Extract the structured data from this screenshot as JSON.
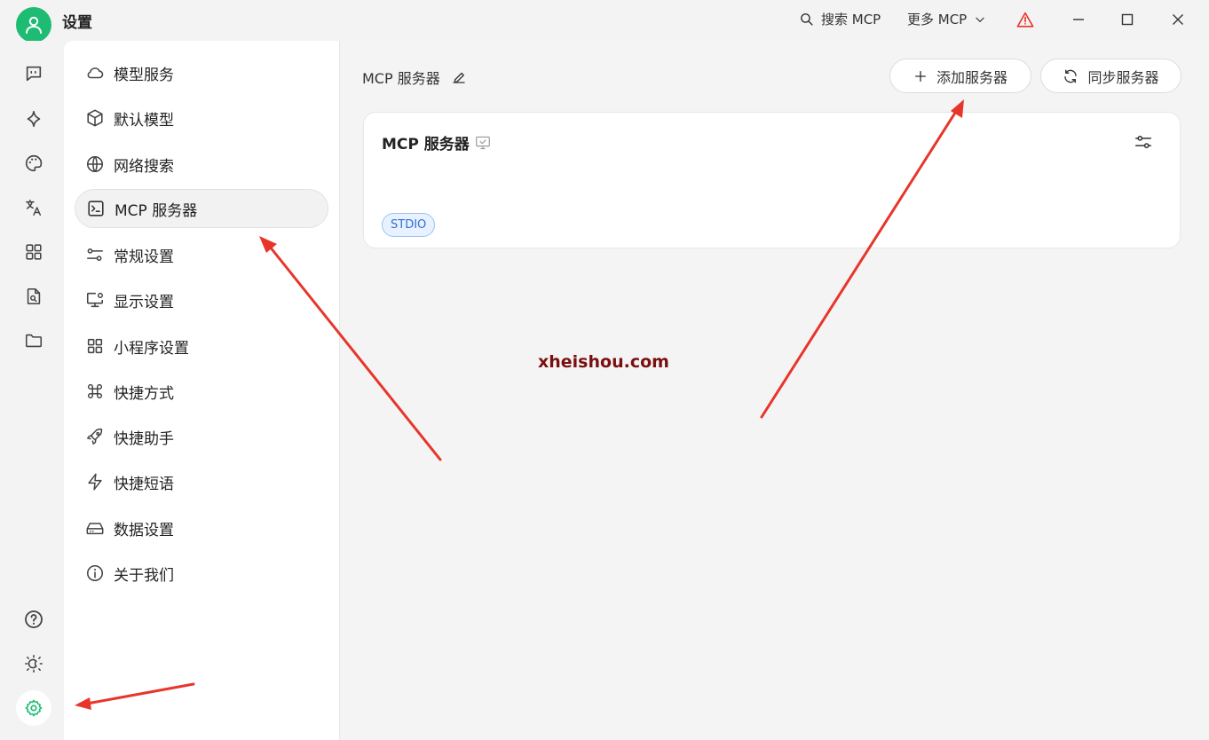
{
  "app": {
    "title": "设置"
  },
  "titlebar": {
    "search_label": "搜索 MCP",
    "more_label": "更多 MCP"
  },
  "sidebar": {
    "items": [
      {
        "label": "模型服务",
        "icon": "cloud-icon"
      },
      {
        "label": "默认模型",
        "icon": "cube-icon"
      },
      {
        "label": "网络搜索",
        "icon": "globe-icon"
      },
      {
        "label": "MCP 服务器",
        "icon": "terminal-icon",
        "active": true
      },
      {
        "label": "常规设置",
        "icon": "sliders-icon"
      },
      {
        "label": "显示设置",
        "icon": "monitor-icon"
      },
      {
        "label": "小程序设置",
        "icon": "grid-icon"
      },
      {
        "label": "快捷方式",
        "icon": "command-icon"
      },
      {
        "label": "快捷助手",
        "icon": "rocket-icon"
      },
      {
        "label": "快捷短语",
        "icon": "zap-icon"
      },
      {
        "label": "数据设置",
        "icon": "hard-drive-icon"
      },
      {
        "label": "关于我们",
        "icon": "info-icon"
      }
    ]
  },
  "main": {
    "title": "MCP 服务器",
    "add_button": "添加服务器",
    "sync_button": "同步服务器",
    "server_card": {
      "name": "MCP 服务器",
      "badge": "STDIO"
    }
  },
  "watermark": "xheishou.com",
  "colors": {
    "accent_green": "#1ebc73",
    "badge_blue": "#2f6fd6",
    "annotation_red": "#e8352b",
    "watermark": "#7a0f0f"
  }
}
